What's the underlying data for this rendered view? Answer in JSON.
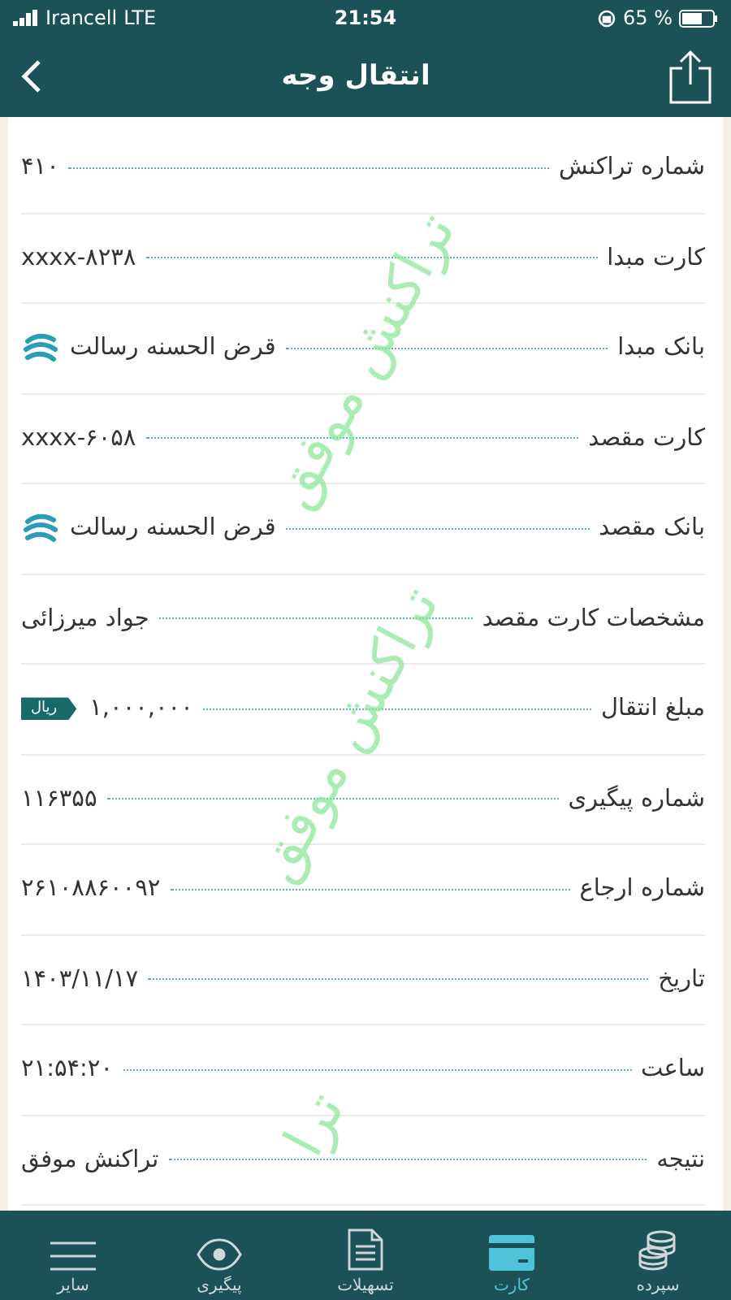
{
  "status_bar": {
    "carrier": "Irancell",
    "network": "LTE",
    "time": "21:54",
    "battery": "65 %"
  },
  "header": {
    "title": "انتقال وجه"
  },
  "rows": [
    {
      "kind": "text",
      "label": "شماره تراکنش",
      "value": "۴۱۰"
    },
    {
      "kind": "text",
      "label": "کارت مبدا",
      "value": "xxxx-۸۲۳۸"
    },
    {
      "kind": "bank",
      "label": "بانک مبدا",
      "value": "قرض الحسنه رسالت"
    },
    {
      "kind": "text",
      "label": "کارت مقصد",
      "value": "xxxx-۶۰۵۸"
    },
    {
      "kind": "bank",
      "label": "بانک مقصد",
      "value": "قرض الحسنه رسالت"
    },
    {
      "kind": "text",
      "label": "مشخصات کارت مقصد",
      "value": "جواد میرزائی"
    },
    {
      "kind": "amount",
      "label": "مبلغ انتقال",
      "value": "۱,۰۰۰,۰۰۰",
      "unit": "ریال"
    },
    {
      "kind": "text",
      "label": "شماره پیگیری",
      "value": "۱۱۶۳۵۵"
    },
    {
      "kind": "text",
      "label": "شماره ارجاع",
      "value": "۲۶۱۰۸۸۶۰۰۹۲"
    },
    {
      "kind": "text",
      "label": "تاریخ",
      "value": "۱۴۰۳/۱۱/۱۷"
    },
    {
      "kind": "text",
      "label": "ساعت",
      "value": "۲۱:۵۴:۲۰"
    },
    {
      "kind": "text",
      "label": "نتیجه",
      "value": "تراکنش موفق"
    }
  ],
  "stamps": [
    "تراکنش موفق",
    "تراکنش موفق",
    "ترا"
  ],
  "tabs": [
    {
      "kind": "deposit",
      "label": "سپرده",
      "selected": false
    },
    {
      "kind": "card",
      "label": "کارت",
      "selected": true
    },
    {
      "kind": "loan",
      "label": "تسهیلات",
      "selected": false
    },
    {
      "kind": "track",
      "label": "پیگیری",
      "selected": false
    },
    {
      "kind": "more",
      "label": "سایر",
      "selected": false
    }
  ]
}
